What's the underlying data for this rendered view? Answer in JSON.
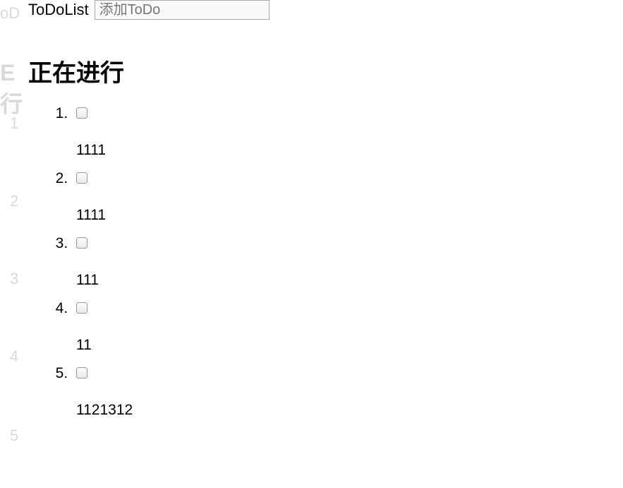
{
  "ghost": {
    "title_fragment": "oD",
    "heading_fragment": "E行",
    "nums": [
      "1",
      "2",
      "3",
      "4",
      "5"
    ]
  },
  "header": {
    "title": "ToDoList",
    "input_placeholder": "添加ToDo",
    "input_value": ""
  },
  "section": {
    "heading": "正在进行"
  },
  "items": [
    {
      "text": "1111",
      "checked": false
    },
    {
      "text": "1111",
      "checked": false
    },
    {
      "text": "111",
      "checked": false
    },
    {
      "text": "11",
      "checked": false
    },
    {
      "text": "1121312",
      "checked": false
    }
  ]
}
